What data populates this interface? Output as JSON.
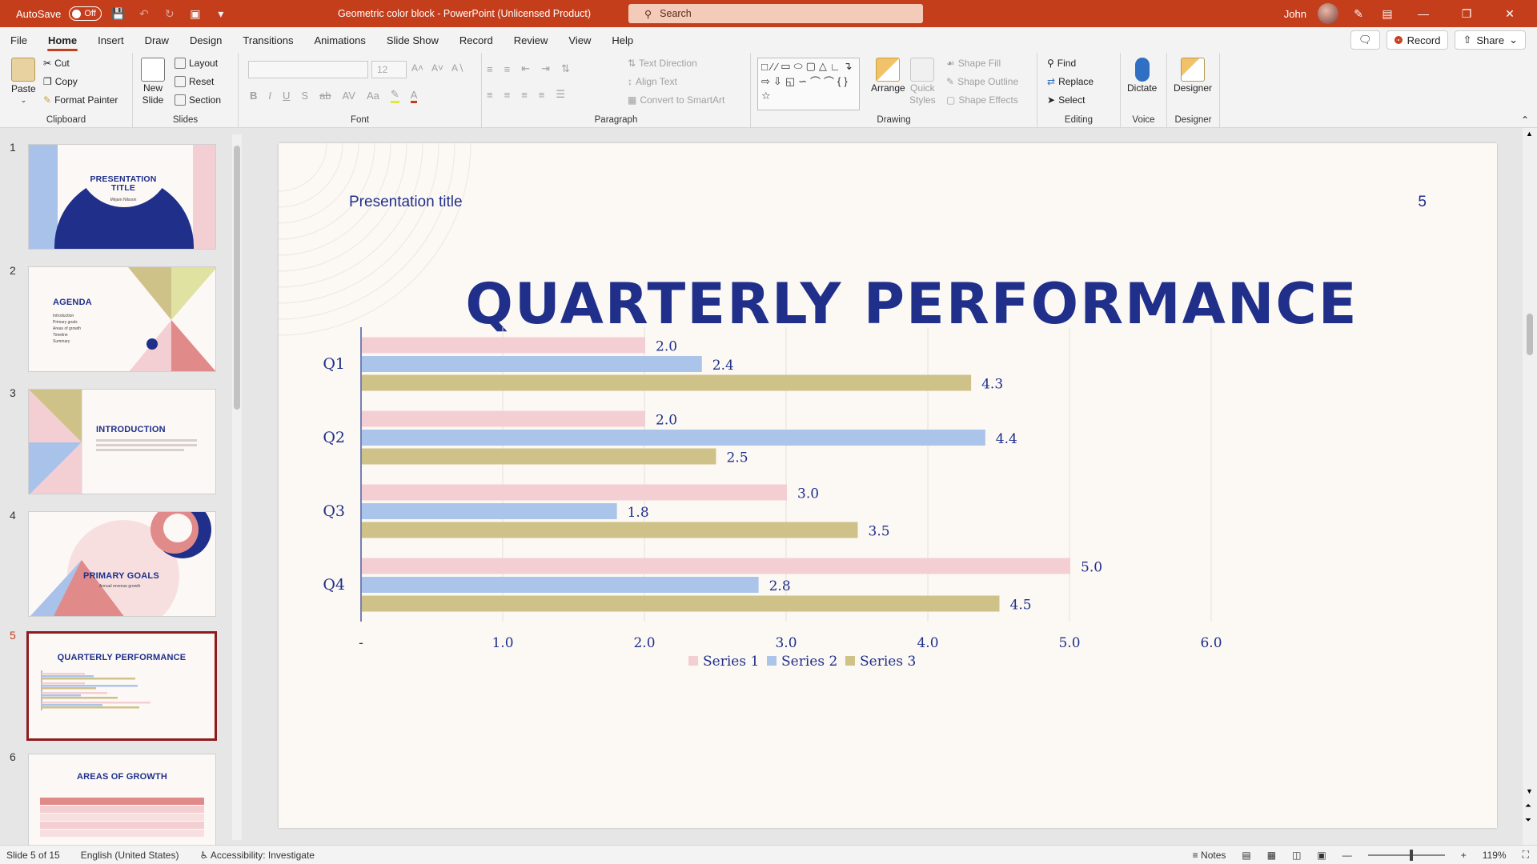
{
  "titlebar": {
    "autosave_label": "AutoSave",
    "autosave_state": "Off",
    "doc_title": "Geometric color block  -  PowerPoint (Unlicensed Product)",
    "search_placeholder": "Search",
    "user_name": "John",
    "accent_color": "#c43e1c"
  },
  "menu": {
    "tabs": [
      "File",
      "Home",
      "Insert",
      "Draw",
      "Design",
      "Transitions",
      "Animations",
      "Slide Show",
      "Record",
      "Review",
      "View",
      "Help"
    ],
    "active_tab": "Home",
    "record_label": "Record",
    "share_label": "Share"
  },
  "ribbon": {
    "clipboard": {
      "label": "Clipboard",
      "paste": "Paste",
      "cut": "Cut",
      "copy": "Copy",
      "format_painter": "Format Painter"
    },
    "slides": {
      "label": "Slides",
      "new_slide_1": "New",
      "new_slide_2": "Slide",
      "layout": "Layout",
      "reset": "Reset",
      "section": "Section"
    },
    "font": {
      "label": "Font",
      "size": "12"
    },
    "paragraph": {
      "label": "Paragraph",
      "text_direction": "Text Direction",
      "align_text": "Align Text",
      "convert_smartart": "Convert to SmartArt"
    },
    "drawing": {
      "label": "Drawing",
      "arrange": "Arrange",
      "quick_styles_1": "Quick",
      "quick_styles_2": "Styles",
      "shape_fill": "Shape Fill",
      "shape_outline": "Shape Outline",
      "shape_effects": "Shape Effects"
    },
    "editing": {
      "label": "Editing",
      "find": "Find",
      "replace": "Replace",
      "select": "Select"
    },
    "voice": {
      "label": "Voice",
      "dictate": "Dictate"
    },
    "designer": {
      "label": "Designer",
      "designer_btn": "Designer"
    }
  },
  "thumbnails": [
    {
      "num": "1",
      "title": "PRESENTATION TITLE",
      "subtitle": "Mirjam Nilsson"
    },
    {
      "num": "2",
      "title": "AGENDA",
      "items": [
        "Introduction",
        "Primary goals",
        "Areas of growth",
        "Timeline",
        "Summary"
      ]
    },
    {
      "num": "3",
      "title": "INTRODUCTION"
    },
    {
      "num": "4",
      "title": "PRIMARY GOALS",
      "subtitle": "Annual revenue growth"
    },
    {
      "num": "5",
      "title": "QUARTERLY PERFORMANCE"
    },
    {
      "num": "6",
      "title": "AREAS OF GROWTH"
    }
  ],
  "slide": {
    "presentation_title": "Presentation title",
    "number": "5",
    "heading": "QUARTERLY PERFORMANCE"
  },
  "chart_data": {
    "type": "bar",
    "orientation": "horizontal",
    "categories": [
      "Q1",
      "Q2",
      "Q3",
      "Q4"
    ],
    "series": [
      {
        "name": "Series 1",
        "color": "#f3cfd3",
        "values": [
          2.0,
          2.0,
          3.0,
          5.0
        ],
        "labels": [
          "2.0",
          "2.0",
          "3.0",
          "5.0"
        ]
      },
      {
        "name": "Series 2",
        "color": "#abc4ea",
        "values": [
          2.4,
          4.4,
          1.8,
          2.8
        ],
        "labels": [
          "2.4",
          "4.4",
          "1.8",
          "2.8"
        ]
      },
      {
        "name": "Series 3",
        "color": "#cfc289",
        "values": [
          4.3,
          2.5,
          3.5,
          4.5
        ],
        "labels": [
          "4.3",
          "2.5",
          "3.5",
          "4.5"
        ]
      }
    ],
    "xlim": [
      0,
      6
    ],
    "x_ticks": [
      0,
      1,
      2,
      3,
      4,
      5,
      6
    ],
    "x_tick_labels": [
      "-",
      "1.0",
      "2.0",
      "3.0",
      "4.0",
      "5.0",
      "6.0"
    ],
    "grid": true,
    "legend": "bottom"
  },
  "status": {
    "slide_of": "Slide 5 of 15",
    "language": "English (United States)",
    "accessibility": "Accessibility: Investigate",
    "notes": "Notes",
    "zoom": "119%"
  }
}
